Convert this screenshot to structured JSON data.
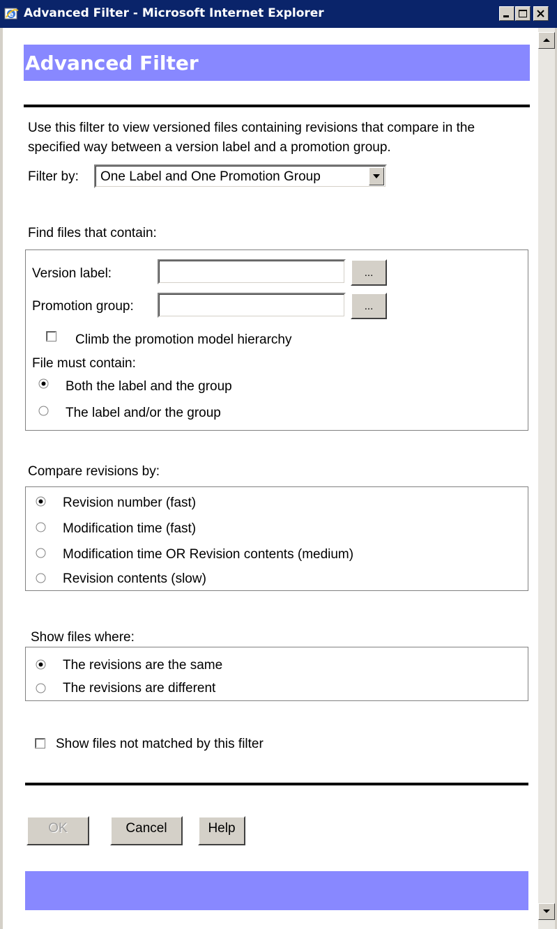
{
  "window": {
    "title": "Advanced Filter - Microsoft Internet Explorer",
    "icon": "ie-icon",
    "buttons": [
      "minimize-icon",
      "maximize-icon",
      "close-icon"
    ]
  },
  "page": {
    "header": "Advanced Filter",
    "intro": "Use this filter to view versioned files containing revisions that compare in the specified way between a version label and a promotion group.",
    "filter_by_label": "Filter by:",
    "filter_by_value": "One Label and One Promotion Group",
    "find_section": {
      "heading": "Find files that contain:",
      "version_label": "Version label:",
      "version_value": "",
      "promotion_group": "Promotion group:",
      "promotion_value": "",
      "browse_label": "...",
      "climb_label": "Climb the promotion model hierarchy",
      "climb_checked": false,
      "must_contain_label": "File must contain:",
      "options": [
        {
          "label": "Both the label and the group",
          "checked": true
        },
        {
          "label": "The label and/or the group",
          "checked": false
        }
      ]
    },
    "compare_section": {
      "heading": "Compare revisions by:",
      "options": [
        {
          "label": "Revision number (fast)",
          "checked": true
        },
        {
          "label": "Modification time (fast)",
          "checked": false
        },
        {
          "label": "Modification time OR Revision contents (medium)",
          "checked": false
        },
        {
          "label": "Revision contents (slow)",
          "checked": false
        }
      ]
    },
    "show_section": {
      "heading": "Show files where:",
      "options": [
        {
          "label": "The revisions are the same",
          "checked": true
        },
        {
          "label": "The revisions are different",
          "checked": false
        }
      ]
    },
    "unmatched_label": "Show files not matched by this filter",
    "unmatched_checked": false,
    "buttons": {
      "ok": "OK",
      "cancel": "Cancel",
      "help": "Help"
    }
  },
  "colors": {
    "titlebar": "#0a246a",
    "header_bar": "#8888ff",
    "chrome": "#d4d0c8"
  }
}
